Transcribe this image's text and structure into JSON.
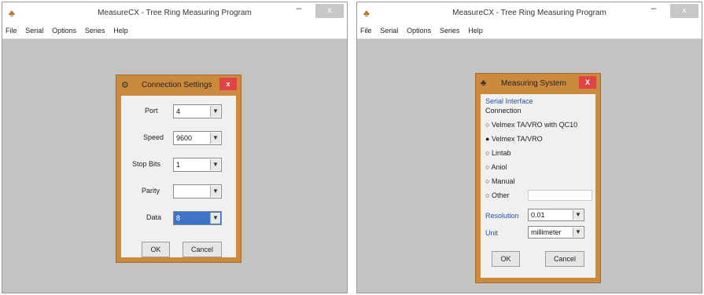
{
  "app": {
    "title": "MeasureCX - Tree Ring Measuring Program",
    "icon": "tree-icon",
    "min_glyph": "–",
    "close_glyph": "x",
    "menus": [
      "File",
      "Serial",
      "Options",
      "Series",
      "Help"
    ]
  },
  "left_dialog": {
    "title": "Connection Settings",
    "close_glyph": "x",
    "fields": [
      {
        "label": "Port",
        "value": "4"
      },
      {
        "label": "Speed",
        "value": "9600"
      },
      {
        "label": "Stop Bits",
        "value": "1"
      },
      {
        "label": "Parity",
        "value": ""
      },
      {
        "label": "Data",
        "value": "8"
      }
    ],
    "ok_label": "OK",
    "cancel_label": "Cancel"
  },
  "right_dialog": {
    "title": "Measuring System",
    "close_glyph": "X",
    "group_label": "Serial Interface",
    "sub_label": "Connection",
    "options": [
      "Velmex TA/VRO with QC10",
      "Velmex TA/VRO",
      "Lintab",
      "Aniol",
      "Manual",
      "Other"
    ],
    "other_value": "",
    "resolution_label": "Resolution",
    "resolution_value": "0.01",
    "unit_label": "Unit",
    "unit_value": "millimeter",
    "ok_label": "OK",
    "cancel_label": "Cancel"
  }
}
